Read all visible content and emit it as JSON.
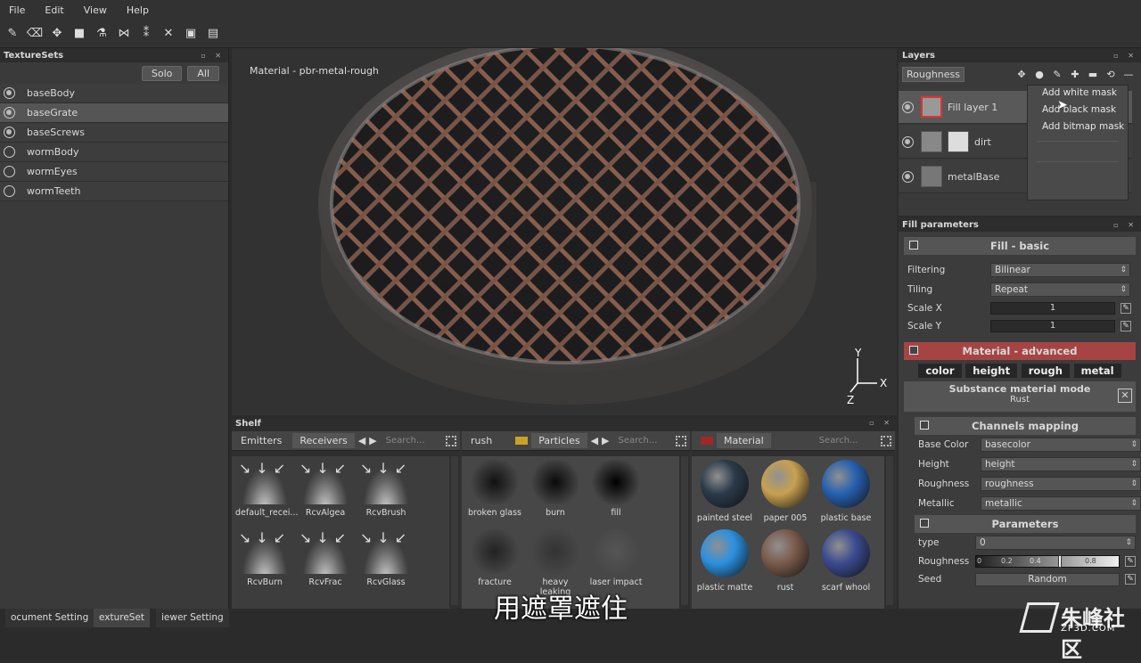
{
  "menu": {
    "file": "File",
    "edit": "Edit",
    "view": "View",
    "help": "Help"
  },
  "texturesets": {
    "title": "TextureSets",
    "solo": "Solo",
    "all": "All",
    "items": [
      {
        "label": "baseBody",
        "active": true,
        "selected": false
      },
      {
        "label": "baseGrate",
        "active": true,
        "selected": true
      },
      {
        "label": "baseScrews",
        "active": true,
        "selected": false
      },
      {
        "label": "wormBody",
        "active": false,
        "selected": false
      },
      {
        "label": "wormEyes",
        "active": false,
        "selected": false
      },
      {
        "label": "wormTeeth",
        "active": false,
        "selected": false
      }
    ]
  },
  "viewport": {
    "material_label": "Material - pbr-metal-rough",
    "axis_y": "Y",
    "axis_x": "X",
    "axis_z": "Z"
  },
  "shelf": {
    "title": "Shelf",
    "left": {
      "tab_emitters": "Emitters",
      "tab_receivers": "Receivers",
      "search": "Search...",
      "items": [
        "default_recei...",
        "RcvAlgea",
        "RcvBrush",
        "RcvBurn",
        "RcvFrac",
        "RcvGlass"
      ]
    },
    "middle": {
      "tab_brush": "rush",
      "tab_particles": "Particles",
      "search": "Search...",
      "items": [
        "broken glass",
        "burn",
        "fill",
        "fracture",
        "heavy leaking",
        "laser impact"
      ]
    },
    "right": {
      "tab_material": "Material",
      "search": "Search...",
      "items": [
        "painted steel",
        "paper 005",
        "plastic base",
        "plastic matte",
        "rust",
        "scarf whool"
      ]
    }
  },
  "layers": {
    "title": "Layers",
    "channel": "Roughness",
    "rows": [
      {
        "name": "Fill layer 1"
      },
      {
        "name": "dirt"
      },
      {
        "name": "metalBase"
      }
    ],
    "dropdown": [
      "Add white mask",
      "Add black mask",
      "Add bitmap mask"
    ]
  },
  "fill": {
    "title": "Fill parameters",
    "basic_header": "Fill - basic",
    "filtering_label": "Filtering",
    "filtering": "Bilinear",
    "tiling_label": "Tiling",
    "tiling": "Repeat",
    "scalex_label": "Scale X",
    "scalex": "1",
    "scaley_label": "Scale Y",
    "scaley": "1",
    "adv_header": "Material - advanced",
    "chips": [
      "color",
      "height",
      "rough",
      "metal"
    ],
    "substance_mode": "Substance material mode",
    "substance_name": "Rust",
    "channels_header": "Channels mapping",
    "map": [
      {
        "label": "Base Color",
        "value": "basecolor"
      },
      {
        "label": "Height",
        "value": "height"
      },
      {
        "label": "Roughness",
        "value": "roughness"
      },
      {
        "label": "Metallic",
        "value": "metallic"
      }
    ],
    "params_header": "Parameters",
    "type_label": "type",
    "type": "0",
    "rough_label": "Roughness",
    "rough_ticks": [
      "0",
      "0.2",
      "0.4",
      "0.8"
    ],
    "seed_label": "Seed",
    "seed_btn": "Random"
  },
  "bottom_tabs": [
    "ocument Setting",
    "extureSet",
    "iewer Setting"
  ],
  "subtitle": "用遮罩遮住",
  "watermark": "朱峰社区",
  "watermark_sub": "ZF3D.COM"
}
